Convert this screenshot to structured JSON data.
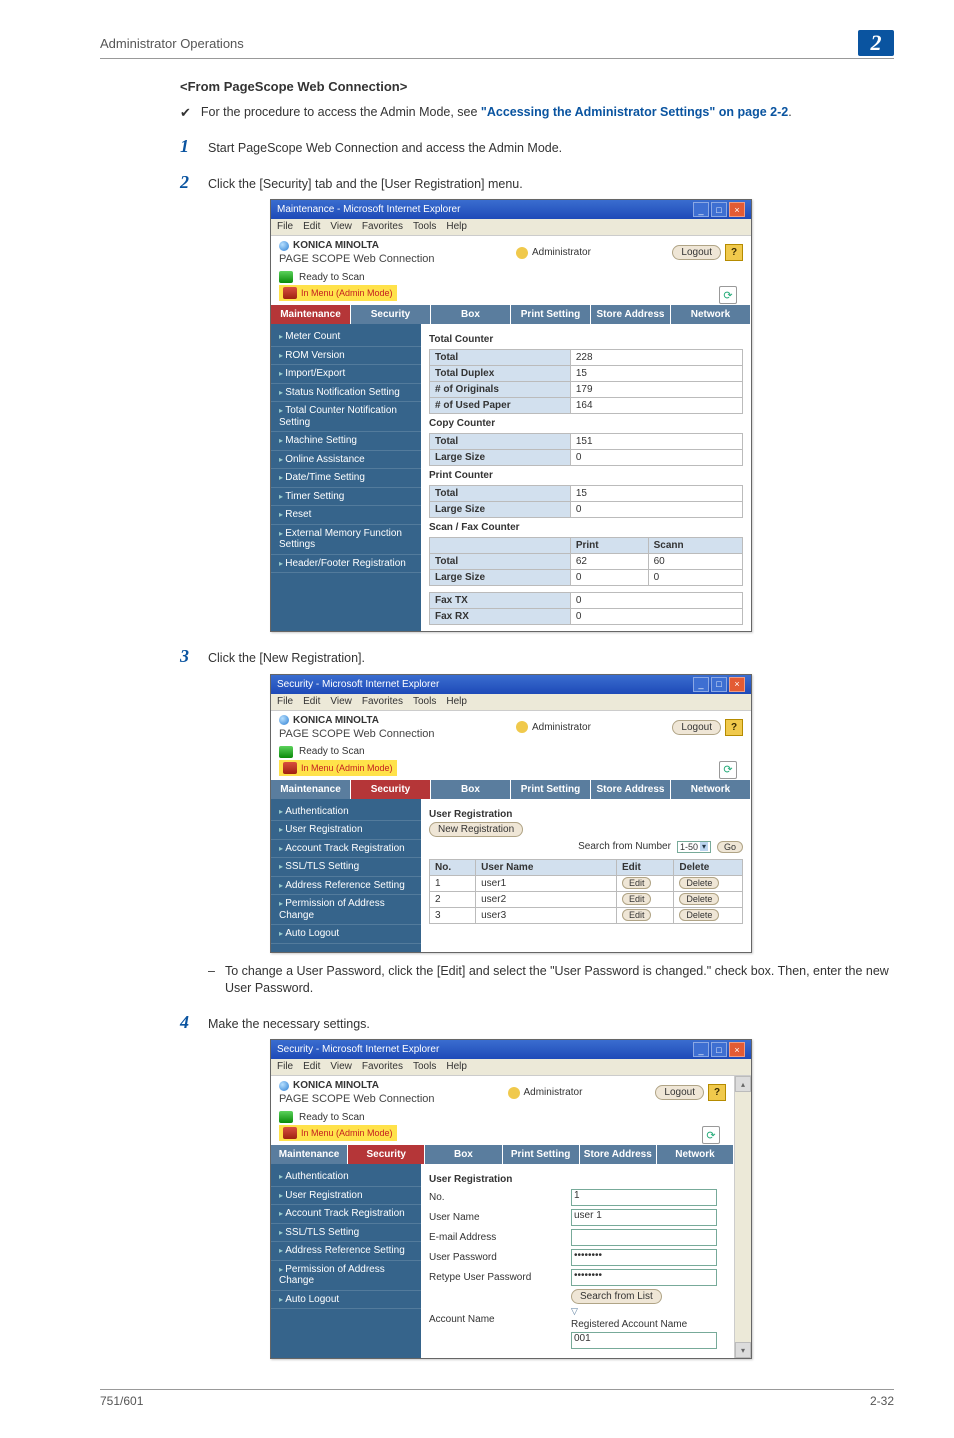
{
  "header": {
    "title": "Administrator Operations",
    "badge": "2"
  },
  "section_title": "<From PageScope Web Connection>",
  "note": {
    "checkmark": "✔",
    "prefix": "For the procedure to access the Admin Mode, see ",
    "link": "\"Accessing the Administrator Settings\" on page 2-2",
    "suffix": "."
  },
  "steps": {
    "s1": {
      "num": "1",
      "text": "Start PageScope Web Connection and access the Admin Mode."
    },
    "s2": {
      "num": "2",
      "text": "Click the [Security] tab and the [User Registration] menu."
    },
    "s3": {
      "num": "3",
      "text": "Click the [New Registration]."
    },
    "s3_sub": {
      "dash": "–",
      "text": "To change a User Password, click the [Edit] and select the \"User Password is changed.\" check box. Then, enter the new User Password."
    },
    "s4": {
      "num": "4",
      "text": "Make the necessary settings."
    }
  },
  "ie": {
    "title1": "Maintenance - Microsoft Internet Explorer",
    "title2": "Security - Microsoft Internet Explorer",
    "menu": {
      "file": "File",
      "edit": "Edit",
      "view": "View",
      "favorites": "Favorites",
      "tools": "Tools",
      "help": "Help"
    }
  },
  "psw": {
    "brand": "KONICA MINOLTA",
    "wc": "PAGE SCOPE Web Connection",
    "admin": "Administrator",
    "logout": "Logout",
    "ready": "Ready to Scan",
    "in_menu": "In Menu (Admin Mode)",
    "tabs": {
      "maintenance": "Maintenance",
      "security": "Security",
      "box": "Box",
      "print_setting": "Print Setting",
      "store_address": "Store Address",
      "network": "Network"
    }
  },
  "shot1": {
    "side": [
      "Meter Count",
      "ROM Version",
      "Import/Export",
      "Status Notification Setting",
      "Total Counter Notification Setting",
      "Machine Setting",
      "Online Assistance",
      "Date/Time Setting",
      "Timer Setting",
      "Reset",
      "External Memory Function Settings",
      "Header/Footer Registration"
    ],
    "total_counter_head": "Total Counter",
    "total_counter": [
      [
        "Total",
        "228"
      ],
      [
        "Total Duplex",
        "15"
      ],
      [
        "# of Originals",
        "179"
      ],
      [
        "# of Used Paper",
        "164"
      ]
    ],
    "copy_head": "Copy Counter",
    "copy_counter": [
      [
        "Total",
        "151"
      ],
      [
        "Large Size",
        "0"
      ]
    ],
    "print_head": "Print Counter",
    "print_counter": [
      [
        "Total",
        "15"
      ],
      [
        "Large Size",
        "0"
      ]
    ],
    "scanfax_head": "Scan / Fax Counter",
    "scanfax_cols": [
      "",
      "Print",
      "Scann"
    ],
    "scanfax_rows": [
      [
        "Total",
        "62",
        "60"
      ],
      [
        "Large Size",
        "0",
        "0"
      ]
    ],
    "fax_rows": [
      [
        "Fax TX",
        "0"
      ],
      [
        "Fax RX",
        "0"
      ]
    ]
  },
  "shot2": {
    "side": [
      "Authentication",
      "User Registration",
      "Account Track Registration",
      "SSL/TLS Setting",
      "Address Reference Setting",
      "Permission of Address Change",
      "Auto Logout"
    ],
    "head": "User Registration",
    "new_reg": "New Registration",
    "search_lbl": "Search from Number",
    "range": "1-50",
    "go": "Go",
    "cols": [
      "No.",
      "User Name",
      "Edit",
      "Delete"
    ],
    "rows": [
      [
        "1",
        "user1",
        "Edit",
        "Delete"
      ],
      [
        "2",
        "user2",
        "Edit",
        "Delete"
      ],
      [
        "3",
        "user3",
        "Edit",
        "Delete"
      ]
    ]
  },
  "shot3": {
    "side": [
      "Authentication",
      "User Registration",
      "Account Track Registration",
      "SSL/TLS Setting",
      "Address Reference Setting",
      "Permission of Address Change",
      "Auto Logout"
    ],
    "head": "User Registration",
    "fields": {
      "no_lbl": "No.",
      "no_val": "1",
      "user_lbl": "User Name",
      "user_val": "user 1",
      "email_lbl": "E-mail Address",
      "email_val": "",
      "pw_lbl": "User Password",
      "pw_val": "••••••••",
      "rpw_lbl": "Retype User Password",
      "rpw_val": "••••••••",
      "acct_lbl": "Account Name",
      "search_btn": "Search from List",
      "reg_lbl": "Registered Account Name",
      "reg_val": "001"
    }
  },
  "footer": {
    "left": "751/601",
    "right": "2-32"
  }
}
